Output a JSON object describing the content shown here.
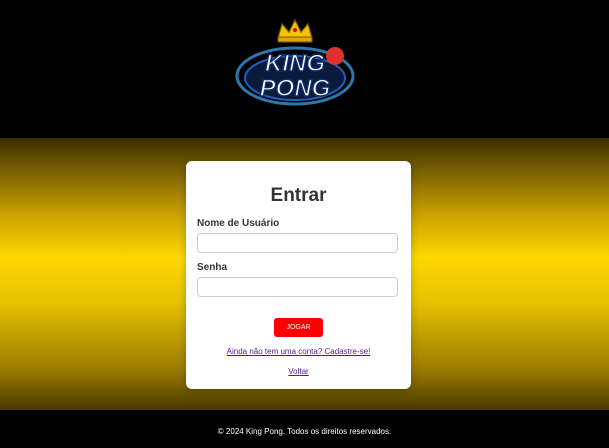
{
  "header": {
    "logo_line1": "KING",
    "logo_line2": "PONG"
  },
  "login": {
    "title": "Entrar",
    "username_label": "Nome de Usuário",
    "username_value": "",
    "password_label": "Senha",
    "password_value": "",
    "submit_label": "JOGAR",
    "register_link": "Ainda não tem uma conta? Cadastre-se!",
    "back_link": "Voltar"
  },
  "footer": {
    "text": "© 2024 King Pong. Todos os direitos reservados."
  },
  "colors": {
    "accent": "#ff0000",
    "gold": "#ffd700",
    "background": "#000000",
    "card": "#ffffff"
  }
}
